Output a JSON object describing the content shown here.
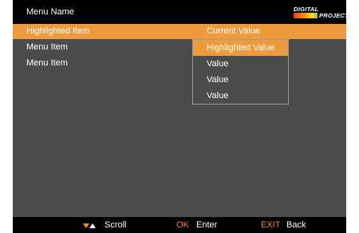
{
  "header": {
    "menu_name": "Menu Name",
    "logo_line1": "DIGITAL",
    "logo_line2": "PROJECTION"
  },
  "rows": [
    {
      "label": "Highlighted Item",
      "value": "Current Value"
    },
    {
      "label": "Menu Item"
    },
    {
      "label": "Menu Item"
    }
  ],
  "dropdown": {
    "options": [
      "Highlighted Value",
      "Value",
      "Value",
      "Value"
    ]
  },
  "footer": {
    "scroll_icon": "up-down-triangle-icon",
    "scroll_label": "Scroll",
    "ok_key": "OK",
    "ok_label": "Enter",
    "exit_key": "EXIT",
    "exit_label": "Back"
  },
  "colors": {
    "background": "#4b4b4b",
    "bar": "#000000",
    "highlight": "#ef9a3c",
    "key_accent": "#f28c28",
    "text": "#ffffff"
  }
}
